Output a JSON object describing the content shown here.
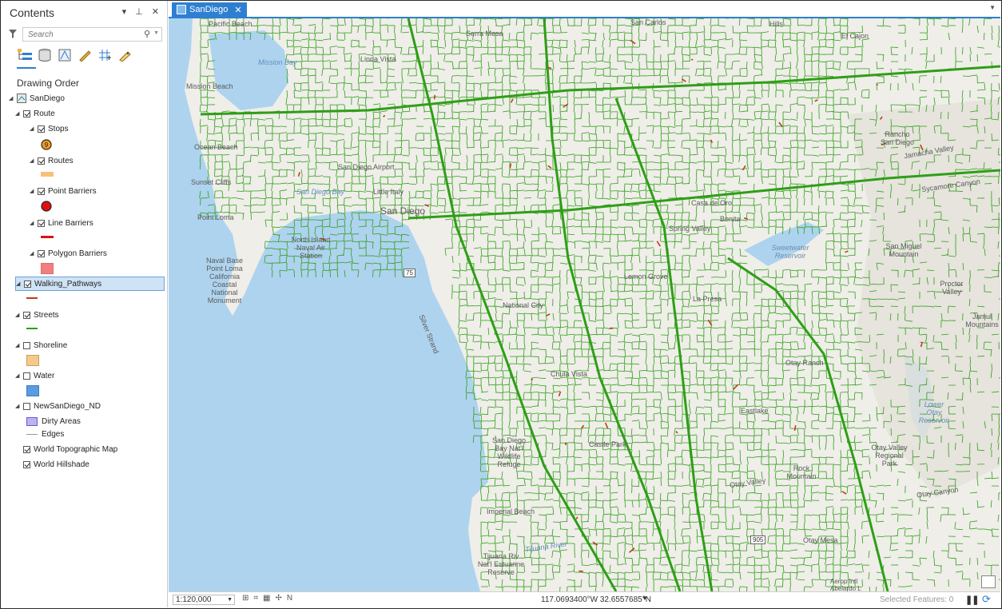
{
  "pane": {
    "title": "Contents",
    "controls": "▾ ⊥ ✕",
    "search_placeholder": "Search",
    "toolbar_icons": [
      "list-by-drawing-order-icon",
      "list-by-data-source-icon",
      "list-by-selection-icon",
      "list-by-editing-icon",
      "list-by-snapping-icon",
      "list-by-labeling-icon"
    ],
    "section_title": "Drawing Order",
    "layers": [
      {
        "label": "SanDiego"
      },
      {
        "label": "Route"
      },
      {
        "label": "Stops",
        "symbol_text": "9"
      },
      {
        "label": "Routes"
      },
      {
        "label": "Point Barriers"
      },
      {
        "label": "Line Barriers"
      },
      {
        "label": "Polygon Barriers"
      },
      {
        "label": "Walking_Pathways"
      },
      {
        "label": "Streets"
      },
      {
        "label": "Shoreline"
      },
      {
        "label": "Water"
      },
      {
        "label": "NewSanDiego_ND"
      },
      {
        "label": "Dirty Areas"
      },
      {
        "label": "Edges"
      },
      {
        "label": "World Topographic Map"
      },
      {
        "label": "World Hillshade"
      }
    ]
  },
  "map_tab": {
    "label": "SanDiego",
    "close": "✕"
  },
  "map_labels": [
    "Pacific Beach",
    "Mission Bay",
    "Mission Beach",
    "Serra Mesa",
    "Linda Vista",
    "San Carlos",
    "Hills",
    "El Cajon",
    "Ocean Beach",
    "Sunset Cliffs",
    "Point Loma",
    "San Diego Airport",
    "San Diego Bay",
    "Little Italy",
    "San Diego",
    "North Island Naval Air Station",
    "Naval Base Point Loma California Coastal National Monument",
    "National City",
    "Chula Vista",
    "Bonita",
    "Sweetwater Reservoir",
    "San Miguel Mountain",
    "Proctor Valley",
    "Jamul Mountains",
    "Lower Otay Reservoir",
    "Otay Valley Regional Park",
    "Rock Mountain",
    "Otay Mesa",
    "Imperial Beach",
    "San Diego Bay Nat'l Wildlife Refuge",
    "Tijuana Riv Nat'l Estuarine Reserve",
    "Tijuana River",
    "Aerop Intl Abelardo L",
    "Rancho San Diego",
    "Casa de Oro",
    "Lemon Grove",
    "Spring Valley",
    "La Presa",
    "Jamacha Valley",
    "Sycamore Canyon",
    "Otay Valley",
    "Otay Canyon",
    "Otay Ranch",
    "Eastlake",
    "Castle Park",
    "Silver Strand"
  ],
  "shields": [
    "905",
    "75"
  ],
  "status": {
    "scale": "1:120,000",
    "coords": "117.0693400°W 32.6557685°N",
    "selected_features": "Selected Features: 0"
  },
  "colors": {
    "accent": "#2e7fd1",
    "streets": "#2f9e17",
    "walking": "#c23a1a",
    "water": "#aed3ef",
    "land": "#efeee9",
    "route_symbol": "#f7c07a",
    "point_barrier": "#e01010",
    "polygon_barrier": "#f08080",
    "shoreline_symbol": "#f5c98a",
    "water_symbol": "#5b9be0",
    "dirty_areas_symbol": "#b9b3f0"
  }
}
